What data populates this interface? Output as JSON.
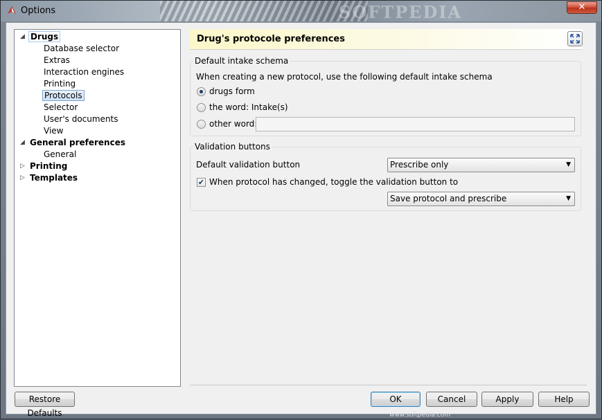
{
  "window": {
    "title": "Options",
    "close_symbol": "✕",
    "watermark": "SOFTPEDIA",
    "watermark_small": "www.softpedia.com"
  },
  "tree": {
    "items": [
      {
        "label": "Drugs",
        "level": 0,
        "bold": true,
        "expander": "expanded"
      },
      {
        "label": "Database selector",
        "level": 1
      },
      {
        "label": "Extras",
        "level": 1
      },
      {
        "label": "Interaction engines",
        "level": 1
      },
      {
        "label": "Printing",
        "level": 1
      },
      {
        "label": "Protocols",
        "level": 1,
        "selected": true
      },
      {
        "label": "Selector",
        "level": 1
      },
      {
        "label": "User's documents",
        "level": 1
      },
      {
        "label": "View",
        "level": 1
      },
      {
        "label": "General preferences",
        "level": 0,
        "bold": true,
        "expander": "expanded"
      },
      {
        "label": "General",
        "level": 1
      },
      {
        "label": "Printing",
        "level": 0,
        "bold": true,
        "expander": "collapsed"
      },
      {
        "label": "Templates",
        "level": 0,
        "bold": true,
        "expander": "collapsed"
      }
    ]
  },
  "page": {
    "title": "Drug's protocole preferences",
    "intake_group": {
      "title": "Default intake schema",
      "description": "When creating a new protocol, use the following default intake schema",
      "options": [
        {
          "label": "drugs form",
          "checked": true
        },
        {
          "label": "the word: Intake(s)",
          "checked": false
        },
        {
          "label": "other word:",
          "checked": false
        }
      ],
      "other_word_value": ""
    },
    "validation_group": {
      "title": "Validation buttons",
      "default_label": "Default validation button",
      "default_value": "Prescribe only",
      "toggle_label": "When protocol has changed, toggle the validation button to",
      "toggle_checked": true,
      "toggle_value": "Save protocol and prescribe"
    }
  },
  "buttons": {
    "restore": "Restore Defaults",
    "ok": "OK",
    "cancel": "Cancel",
    "apply": "Apply",
    "help": "Help"
  },
  "colors": {
    "selection": "#cfe1f7",
    "header_accent": "#fbf7c9",
    "close": "#c9462f"
  }
}
